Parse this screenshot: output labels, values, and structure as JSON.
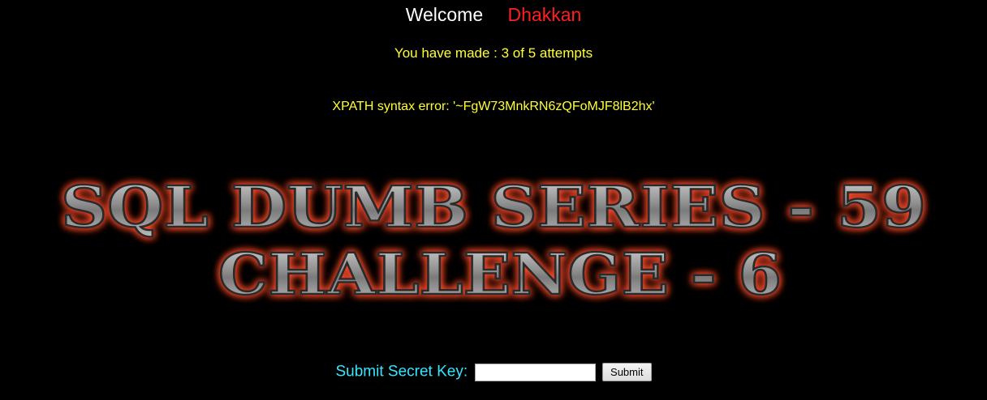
{
  "header": {
    "welcome": "Welcome",
    "username": "Dhakkan"
  },
  "status": {
    "attempts_text": "You have made : 3 of 5 attempts",
    "attempts_made": 3,
    "attempts_total": 5
  },
  "error": {
    "message": "XPATH syntax error: '~FgW73MnkRN6zQFoMJF8lB2hx'"
  },
  "banner": {
    "line1": "SQL DUMB SERIES - 59",
    "line2": "CHALLENGE - 6",
    "glow_color": "#ff4a2a",
    "text_color": "#9a9a9a"
  },
  "form": {
    "label": "Submit Secret Key:",
    "input_value": "",
    "submit_label": "Submit"
  },
  "colors": {
    "background": "#000000",
    "welcome": "#ffffff",
    "username": "#ff1f1f",
    "status": "#ffff33",
    "label": "#33e6ff"
  }
}
